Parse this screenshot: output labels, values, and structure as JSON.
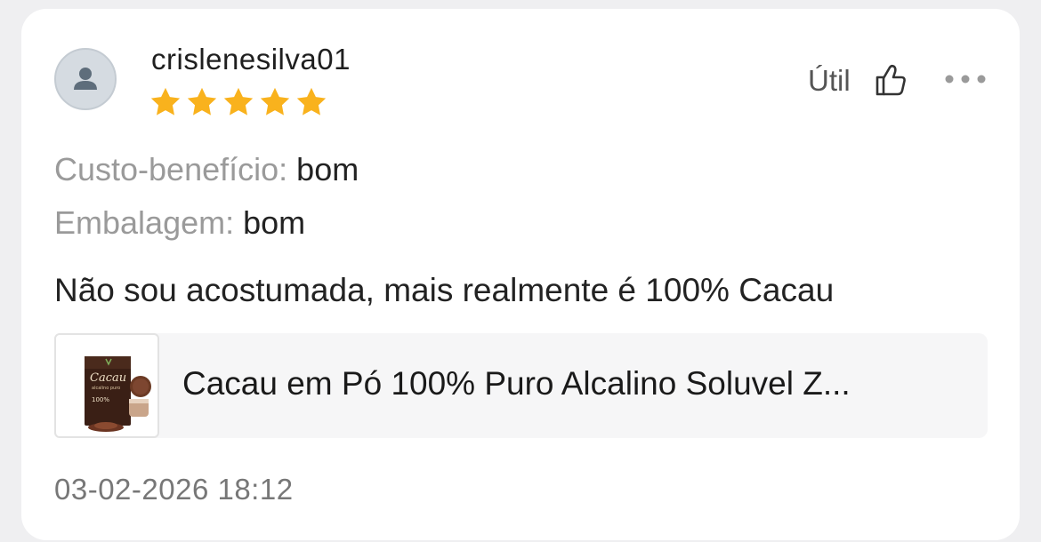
{
  "review": {
    "username": "crislenesilva01",
    "rating": 5,
    "rating_max": 5,
    "useful_label": "Útil",
    "attributes": [
      {
        "label": "Custo-benefício:",
        "value": "bom"
      },
      {
        "label": "Embalagem:",
        "value": "bom"
      }
    ],
    "text": "Não sou acostumada, mais realmente é 100% Cacau",
    "product_title": "Cacau em Pó 100% Puro Alcalino Soluvel  Z...",
    "date": "03-02-2026 18:12"
  },
  "product_image_text": {
    "brand": "Cacau",
    "subtitle": "alcalino puro",
    "badge": "100%"
  },
  "icons": [
    "user-avatar-icon",
    "star-icon",
    "thumbs-up-icon",
    "more-options-icon"
  ],
  "colors": {
    "star": "#f9b21d",
    "background": "#efeff1",
    "card": "#ffffff"
  }
}
